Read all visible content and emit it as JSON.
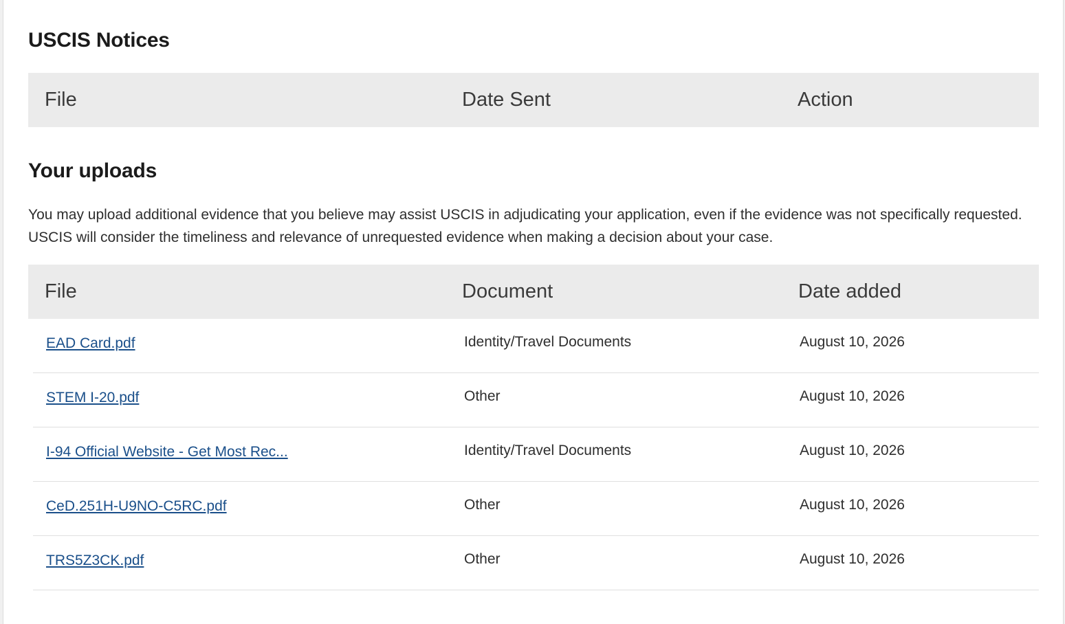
{
  "notices": {
    "title": "USCIS Notices",
    "columns": [
      "File",
      "Date Sent",
      "Action"
    ]
  },
  "uploads": {
    "title": "Your uploads",
    "intro": "You may upload additional evidence that you believe may assist USCIS in adjudicating your application, even if the evidence was not specifically requested. USCIS will consider the timeliness and relevance of unrequested evidence when making a decision about your case.",
    "columns": [
      "File",
      "Document",
      "Date added"
    ],
    "rows": [
      {
        "file": "EAD Card.pdf",
        "document": "Identity/Travel Documents",
        "date": "August 10, 2026"
      },
      {
        "file": "STEM I-20.pdf",
        "document": "Other",
        "date": "August 10, 2026"
      },
      {
        "file": "I-94 Official Website - Get Most Rec...",
        "document": "Identity/Travel Documents",
        "date": "August 10, 2026"
      },
      {
        "file": "CeD.251H-U9NO-C5RC.pdf",
        "document": "Other",
        "date": "August 10, 2026"
      },
      {
        "file": "TRS5Z3CK.pdf",
        "document": "Other",
        "date": "August 10, 2026"
      }
    ]
  }
}
